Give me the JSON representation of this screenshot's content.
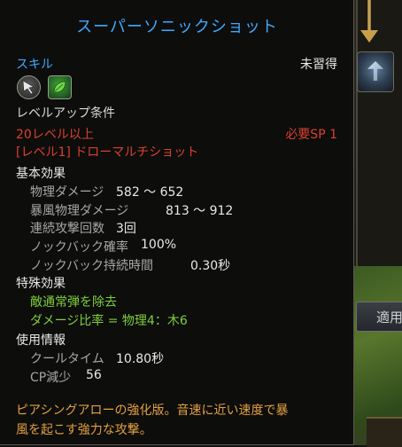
{
  "tooltip": {
    "title": "スーパーソニックショット",
    "section_skill": "スキル",
    "status": "未習得",
    "icons": [
      "arrow-skill-icon",
      "leaf-skill-icon"
    ],
    "levelup_heading": "レベルアップ条件",
    "req_level": "20レベル以上",
    "req_sp": "必要SP 1",
    "req_skill": "[レベル1] ドローマルチショット",
    "basic_heading": "基本効果",
    "basic_rows": [
      {
        "label": "物理ダメージ",
        "value": "582 ～ 652"
      },
      {
        "label": "暴風物理ダメージ",
        "value": "813 ～ 912"
      },
      {
        "label": "連続攻撃回数",
        "value": "3回"
      },
      {
        "label": "ノックバック確率",
        "value": "100%"
      },
      {
        "label": "ノックバック持続時間",
        "value": "0.30秒"
      }
    ],
    "special_heading": "特殊効果",
    "special_rows": [
      "敵通常弾を除去",
      "ダメージ比率 = 物理4：木6"
    ],
    "usage_heading": "使用情報",
    "usage_rows": [
      {
        "label": "クールタイム",
        "value": "10.80秒"
      },
      {
        "label": "CP減少",
        "value": "56"
      }
    ],
    "description_line1": "ピアシングアローの強化版。音速に近い速度で暴",
    "description_line2": "風を起こす強力な攻撃。"
  },
  "background": {
    "apply_button": "適用"
  },
  "colors": {
    "title_blue": "#3fa9ff",
    "requirement_red": "#d9412f",
    "special_green": "#7fcf3a",
    "description_orange": "#e2a13f"
  }
}
